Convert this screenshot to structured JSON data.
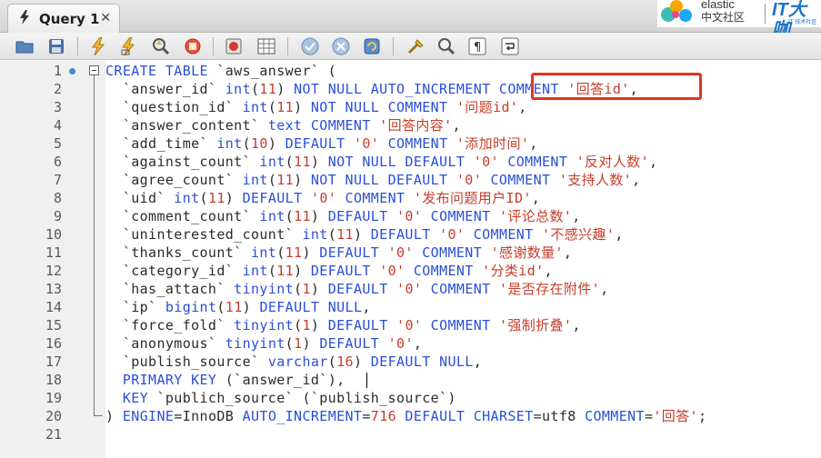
{
  "tab": {
    "title": "Query 1",
    "close": "✕"
  },
  "watermark": {
    "elastic_word": "elastic",
    "elastic_cn": "中文社区",
    "brand_mark": "IT大咖",
    "brand_sub": "IT 技术社区"
  },
  "toolbar": {
    "icons": [
      "open-folder-icon",
      "save-icon",
      "execute-icon",
      "execute-current-icon",
      "explain-icon",
      "stop-icon",
      "toggle-error-icon",
      "results-grid-icon",
      "commit-icon",
      "rollback-icon",
      "autocommit-icon",
      "beautify-icon",
      "find-icon",
      "invisible-chars-icon",
      "wrap-lines-icon"
    ]
  },
  "editor": {
    "line_numbers": [
      "1",
      "2",
      "3",
      "4",
      "5",
      "6",
      "7",
      "8",
      "9",
      "10",
      "11",
      "12",
      "13",
      "14",
      "15",
      "16",
      "17",
      "18",
      "19",
      "20",
      "21"
    ],
    "code": [
      [
        {
          "t": "CREATE TABLE ",
          "c": "k"
        },
        {
          "t": "`aws_answer` (",
          "c": "i"
        }
      ],
      [
        {
          "t": "  `answer_id` ",
          "c": "i"
        },
        {
          "t": "int",
          "c": "k"
        },
        {
          "t": "(",
          "c": "i"
        },
        {
          "t": "11",
          "c": "s"
        },
        {
          "t": ") ",
          "c": "i"
        },
        {
          "t": "NOT NULL AUTO_INCREMENT COMMENT ",
          "c": "k"
        },
        {
          "t": "'回答id'",
          "c": "s"
        },
        {
          "t": ",",
          "c": "i"
        }
      ],
      [
        {
          "t": "  `question_id` ",
          "c": "i"
        },
        {
          "t": "int",
          "c": "k"
        },
        {
          "t": "(",
          "c": "i"
        },
        {
          "t": "11",
          "c": "s"
        },
        {
          "t": ") ",
          "c": "i"
        },
        {
          "t": "NOT NULL COMMENT ",
          "c": "k"
        },
        {
          "t": "'问题id'",
          "c": "s"
        },
        {
          "t": ",",
          "c": "i"
        }
      ],
      [
        {
          "t": "  `answer_content` ",
          "c": "i"
        },
        {
          "t": "text COMMENT ",
          "c": "k"
        },
        {
          "t": "'回答内容'",
          "c": "s"
        },
        {
          "t": ",",
          "c": "i"
        }
      ],
      [
        {
          "t": "  `add_time` ",
          "c": "i"
        },
        {
          "t": "int",
          "c": "k"
        },
        {
          "t": "(",
          "c": "i"
        },
        {
          "t": "10",
          "c": "s"
        },
        {
          "t": ") ",
          "c": "i"
        },
        {
          "t": "DEFAULT ",
          "c": "k"
        },
        {
          "t": "'0'",
          "c": "s"
        },
        {
          "t": " COMMENT ",
          "c": "k"
        },
        {
          "t": "'添加时间'",
          "c": "s"
        },
        {
          "t": ",",
          "c": "i"
        }
      ],
      [
        {
          "t": "  `against_count` ",
          "c": "i"
        },
        {
          "t": "int",
          "c": "k"
        },
        {
          "t": "(",
          "c": "i"
        },
        {
          "t": "11",
          "c": "s"
        },
        {
          "t": ") ",
          "c": "i"
        },
        {
          "t": "NOT NULL DEFAULT ",
          "c": "k"
        },
        {
          "t": "'0'",
          "c": "s"
        },
        {
          "t": " COMMENT ",
          "c": "k"
        },
        {
          "t": "'反对人数'",
          "c": "s"
        },
        {
          "t": ",",
          "c": "i"
        }
      ],
      [
        {
          "t": "  `agree_count` ",
          "c": "i"
        },
        {
          "t": "int",
          "c": "k"
        },
        {
          "t": "(",
          "c": "i"
        },
        {
          "t": "11",
          "c": "s"
        },
        {
          "t": ") ",
          "c": "i"
        },
        {
          "t": "NOT NULL DEFAULT ",
          "c": "k"
        },
        {
          "t": "'0'",
          "c": "s"
        },
        {
          "t": " COMMENT ",
          "c": "k"
        },
        {
          "t": "'支持人数'",
          "c": "s"
        },
        {
          "t": ",",
          "c": "i"
        }
      ],
      [
        {
          "t": "  `uid` ",
          "c": "i"
        },
        {
          "t": "int",
          "c": "k"
        },
        {
          "t": "(",
          "c": "i"
        },
        {
          "t": "11",
          "c": "s"
        },
        {
          "t": ") ",
          "c": "i"
        },
        {
          "t": "DEFAULT ",
          "c": "k"
        },
        {
          "t": "'0'",
          "c": "s"
        },
        {
          "t": " COMMENT ",
          "c": "k"
        },
        {
          "t": "'发布问题用户ID'",
          "c": "s"
        },
        {
          "t": ",",
          "c": "i"
        }
      ],
      [
        {
          "t": "  `comment_count` ",
          "c": "i"
        },
        {
          "t": "int",
          "c": "k"
        },
        {
          "t": "(",
          "c": "i"
        },
        {
          "t": "11",
          "c": "s"
        },
        {
          "t": ") ",
          "c": "i"
        },
        {
          "t": "DEFAULT ",
          "c": "k"
        },
        {
          "t": "'0'",
          "c": "s"
        },
        {
          "t": " COMMENT ",
          "c": "k"
        },
        {
          "t": "'评论总数'",
          "c": "s"
        },
        {
          "t": ",",
          "c": "i"
        }
      ],
      [
        {
          "t": "  `uninterested_count` ",
          "c": "i"
        },
        {
          "t": "int",
          "c": "k"
        },
        {
          "t": "(",
          "c": "i"
        },
        {
          "t": "11",
          "c": "s"
        },
        {
          "t": ") ",
          "c": "i"
        },
        {
          "t": "DEFAULT ",
          "c": "k"
        },
        {
          "t": "'0'",
          "c": "s"
        },
        {
          "t": " COMMENT ",
          "c": "k"
        },
        {
          "t": "'不感兴趣'",
          "c": "s"
        },
        {
          "t": ",",
          "c": "i"
        }
      ],
      [
        {
          "t": "  `thanks_count` ",
          "c": "i"
        },
        {
          "t": "int",
          "c": "k"
        },
        {
          "t": "(",
          "c": "i"
        },
        {
          "t": "11",
          "c": "s"
        },
        {
          "t": ") ",
          "c": "i"
        },
        {
          "t": "DEFAULT ",
          "c": "k"
        },
        {
          "t": "'0'",
          "c": "s"
        },
        {
          "t": " COMMENT ",
          "c": "k"
        },
        {
          "t": "'感谢数量'",
          "c": "s"
        },
        {
          "t": ",",
          "c": "i"
        }
      ],
      [
        {
          "t": "  `category_id` ",
          "c": "i"
        },
        {
          "t": "int",
          "c": "k"
        },
        {
          "t": "(",
          "c": "i"
        },
        {
          "t": "11",
          "c": "s"
        },
        {
          "t": ") ",
          "c": "i"
        },
        {
          "t": "DEFAULT ",
          "c": "k"
        },
        {
          "t": "'0'",
          "c": "s"
        },
        {
          "t": " COMMENT ",
          "c": "k"
        },
        {
          "t": "'分类id'",
          "c": "s"
        },
        {
          "t": ",",
          "c": "i"
        }
      ],
      [
        {
          "t": "  `has_attach` ",
          "c": "i"
        },
        {
          "t": "tinyint",
          "c": "k"
        },
        {
          "t": "(",
          "c": "i"
        },
        {
          "t": "1",
          "c": "s"
        },
        {
          "t": ") ",
          "c": "i"
        },
        {
          "t": "DEFAULT ",
          "c": "k"
        },
        {
          "t": "'0'",
          "c": "s"
        },
        {
          "t": " COMMENT ",
          "c": "k"
        },
        {
          "t": "'是否存在附件'",
          "c": "s"
        },
        {
          "t": ",",
          "c": "i"
        }
      ],
      [
        {
          "t": "  `ip` ",
          "c": "i"
        },
        {
          "t": "bigint",
          "c": "k"
        },
        {
          "t": "(",
          "c": "i"
        },
        {
          "t": "11",
          "c": "s"
        },
        {
          "t": ") ",
          "c": "i"
        },
        {
          "t": "DEFAULT NULL",
          "c": "k"
        },
        {
          "t": ",",
          "c": "i"
        }
      ],
      [
        {
          "t": "  `force_fold` ",
          "c": "i"
        },
        {
          "t": "tinyint",
          "c": "k"
        },
        {
          "t": "(",
          "c": "i"
        },
        {
          "t": "1",
          "c": "s"
        },
        {
          "t": ") ",
          "c": "i"
        },
        {
          "t": "DEFAULT ",
          "c": "k"
        },
        {
          "t": "'0'",
          "c": "s"
        },
        {
          "t": " COMMENT ",
          "c": "k"
        },
        {
          "t": "'强制折叠'",
          "c": "s"
        },
        {
          "t": ",",
          "c": "i"
        }
      ],
      [
        {
          "t": "  `anonymous` ",
          "c": "i"
        },
        {
          "t": "tinyint",
          "c": "k"
        },
        {
          "t": "(",
          "c": "i"
        },
        {
          "t": "1",
          "c": "s"
        },
        {
          "t": ") ",
          "c": "i"
        },
        {
          "t": "DEFAULT ",
          "c": "k"
        },
        {
          "t": "'0'",
          "c": "s"
        },
        {
          "t": ",",
          "c": "i"
        }
      ],
      [
        {
          "t": "  `publish_source` ",
          "c": "i"
        },
        {
          "t": "varchar",
          "c": "k"
        },
        {
          "t": "(",
          "c": "i"
        },
        {
          "t": "16",
          "c": "s"
        },
        {
          "t": ") ",
          "c": "i"
        },
        {
          "t": "DEFAULT NULL",
          "c": "k"
        },
        {
          "t": ",",
          "c": "i"
        }
      ],
      [
        {
          "t": "  PRIMARY KEY ",
          "c": "k"
        },
        {
          "t": "(`answer_id`),",
          "c": "i"
        }
      ],
      [
        {
          "t": "  KEY ",
          "c": "k"
        },
        {
          "t": "`publich_source` (`publish_source`)",
          "c": "i"
        }
      ],
      [
        {
          "t": ") ",
          "c": "i"
        },
        {
          "t": "ENGINE",
          "c": "k"
        },
        {
          "t": "=InnoDB ",
          "c": "i"
        },
        {
          "t": "AUTO_INCREMENT",
          "c": "k"
        },
        {
          "t": "=",
          "c": "i"
        },
        {
          "t": "716",
          "c": "s"
        },
        {
          "t": " DEFAULT CHARSET",
          "c": "k"
        },
        {
          "t": "=utf8 ",
          "c": "i"
        },
        {
          "t": "COMMENT",
          "c": "k"
        },
        {
          "t": "=",
          "c": "i"
        },
        {
          "t": "'回答'",
          "c": "s"
        },
        {
          "t": ";",
          "c": "i"
        }
      ],
      []
    ]
  },
  "colors": {
    "keyword": "#2a4fd8",
    "string": "#c83d2a",
    "highlight_box": "#e8331f"
  }
}
